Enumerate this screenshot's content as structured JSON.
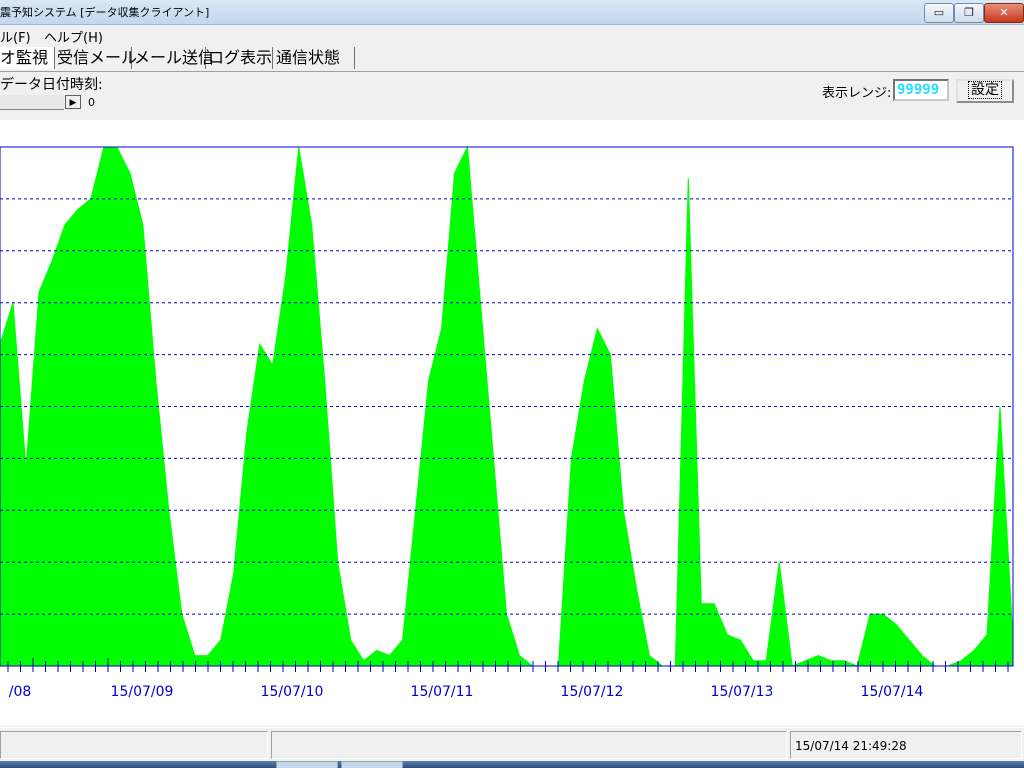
{
  "window": {
    "title": "震予知システム [データ収集クライアント]"
  },
  "menu": {
    "file": "ル(F)",
    "help": "ヘルプ(H)"
  },
  "tabs": [
    "オ監視",
    "受信メール",
    "メール送信",
    "ログ表示",
    "通信状態"
  ],
  "data_time": {
    "label": "データ日付時刻:",
    "scroll_value": "0"
  },
  "display_range": {
    "label": "表示レンジ:",
    "value": "99999",
    "button": "設定"
  },
  "colors": {
    "series": "#00ff00",
    "grid": "#0000cc"
  },
  "chart_data": {
    "type": "area",
    "x_tick_labels": [
      "/08",
      "15/07/09",
      "15/07/10",
      "15/07/11",
      "15/07/12",
      "15/07/13",
      "15/07/14"
    ],
    "grid": "dashed horizontal lines",
    "ylim": [
      0,
      99999
    ],
    "series": [
      {
        "values": [
          0.62,
          0.7,
          0.38,
          0.72,
          0.78,
          0.85,
          0.88,
          0.9,
          1.0,
          1.0,
          0.95,
          0.85,
          0.55,
          0.3,
          0.1,
          0.02,
          0.02,
          0.05,
          0.18,
          0.45,
          0.62,
          0.58,
          0.75,
          1.0,
          0.85,
          0.55,
          0.2,
          0.05,
          0.01,
          0.03,
          0.02,
          0.05,
          0.3,
          0.55,
          0.65,
          0.95,
          1.0,
          0.7,
          0.4,
          0.1,
          0.02,
          0.0,
          0.0,
          0.0,
          0.4,
          0.55,
          0.65,
          0.6,
          0.3,
          0.15,
          0.02,
          0.0,
          0.0,
          0.94,
          0.12,
          0.12,
          0.06,
          0.05,
          0.01,
          0.01,
          0.2,
          0.0,
          0.01,
          0.02,
          0.01,
          0.01,
          0.0,
          0.1,
          0.1,
          0.08,
          0.05,
          0.02,
          0.0,
          0.0,
          0.01,
          0.03,
          0.06,
          0.5,
          0.05
        ]
      }
    ]
  },
  "status": {
    "datetime": "15/07/14 21:49:28"
  }
}
